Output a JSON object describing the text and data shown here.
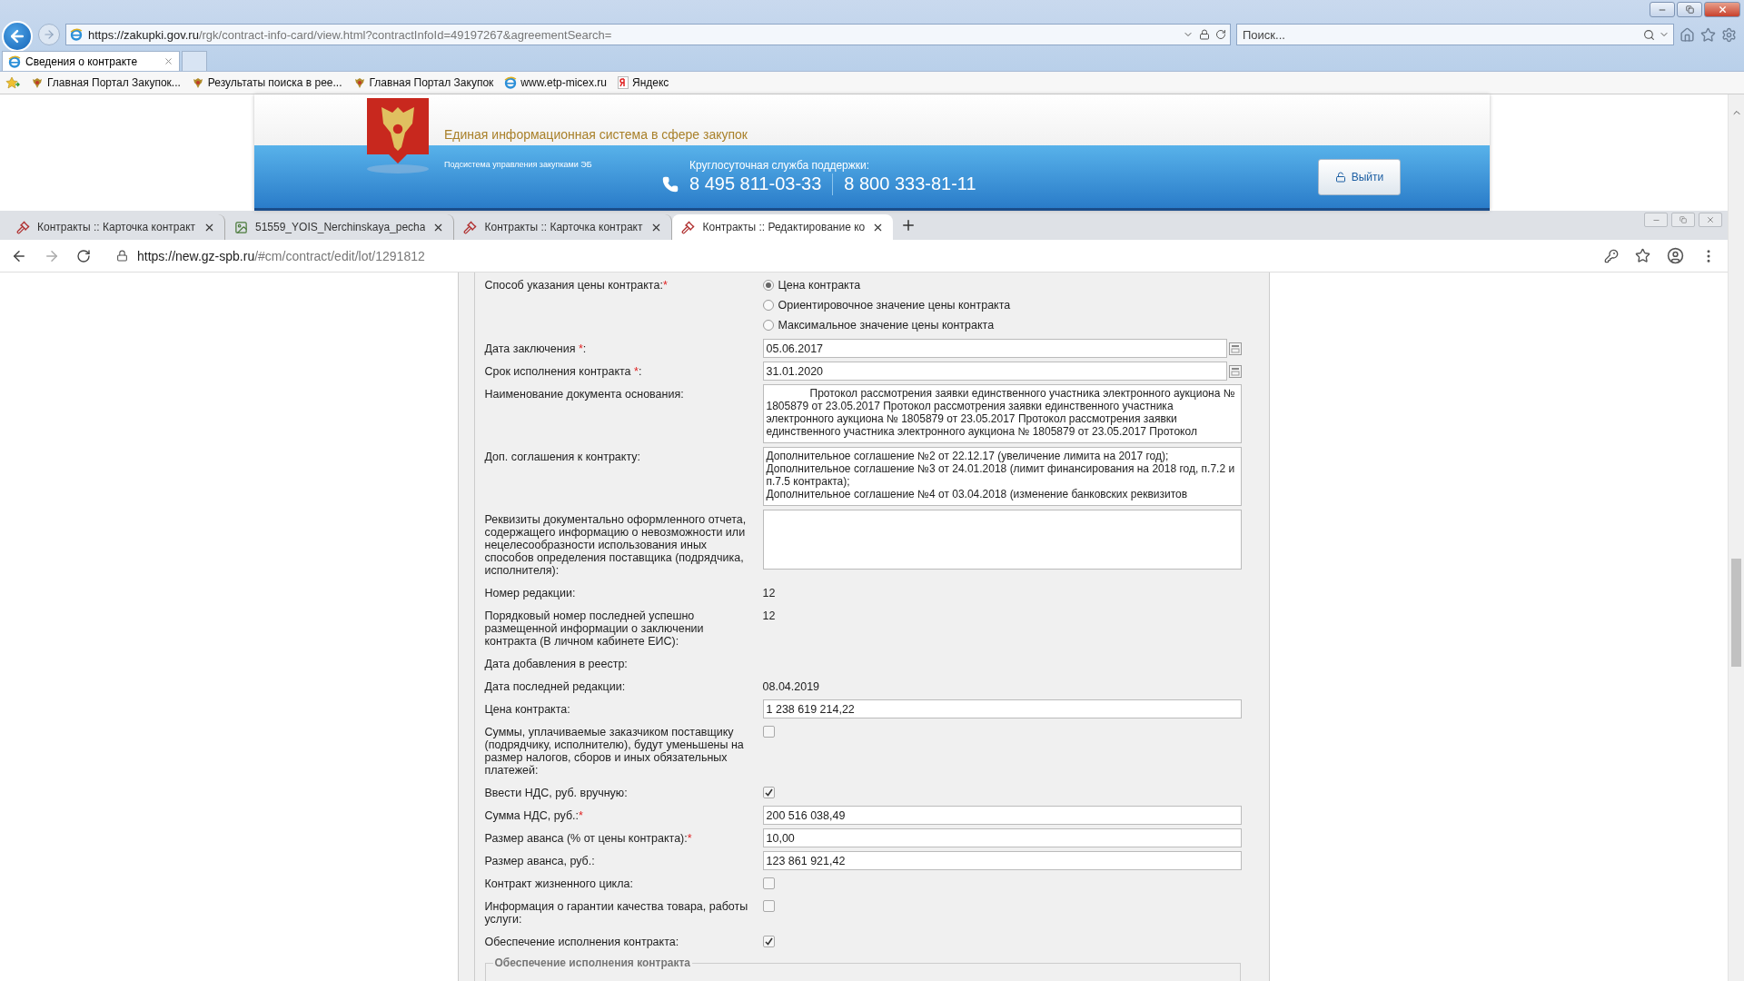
{
  "ie": {
    "address_host": "https://zakupki.gov.ru",
    "address_path": "/rgk/contract-info-card/view.html?contractInfoId=49197267&agreementSearch=",
    "search_placeholder": "Поиск...",
    "tab": {
      "title": "Сведения о контракте",
      "selected": true
    },
    "favorites": [
      {
        "kind": "gov",
        "label": "Главная Портал Закупок..."
      },
      {
        "kind": "gov",
        "label": "Результаты поиска в рее..."
      },
      {
        "kind": "gov",
        "label": "Главная Портал Закупок"
      },
      {
        "kind": "web",
        "label": "www.etp-micex.ru"
      },
      {
        "kind": "search",
        "label": "Яндекс"
      }
    ]
  },
  "eis_header": {
    "title": "Единая информационная система в сфере закупок",
    "subsystem": "Подсистема управления закупками ЭБ",
    "support_label": "Круглосуточная служба поддержки:",
    "phones": [
      "8 495 811-03-33",
      "8 800 333-81-11"
    ],
    "logout": "Выйти"
  },
  "chrome": {
    "tabs": [
      {
        "kind": "app",
        "title": "Контракты :: Карточка контракт",
        "selected": false
      },
      {
        "kind": "doc",
        "title": "51559_YOIS_Nerchinskaya_pecha",
        "selected": false
      },
      {
        "kind": "app",
        "title": "Контракты :: Карточка контракт",
        "selected": false
      },
      {
        "kind": "app",
        "title": "Контракты :: Редактирование ко",
        "selected": true
      }
    ],
    "address_host": "https://new.gz-spb.ru",
    "address_path": "/#cm/contract/edit/lot/1291812"
  },
  "form": {
    "rows": [
      {
        "kind": "radio",
        "label": "Способ указания цены контракта:",
        "required_mark": "*",
        "options": [
          {
            "label": "Цена контракта",
            "selected": true
          },
          {
            "label": "Ориентировочное значение цены контракта",
            "selected": false
          },
          {
            "label": "Максимальное значение цены контракта",
            "selected": false
          }
        ]
      },
      {
        "kind": "date",
        "label": "Дата заключения ",
        "required_mark": "*",
        "label_tail": ":",
        "value": "05.06.2017"
      },
      {
        "kind": "date",
        "label": "Срок исполнения контракта ",
        "required_mark": "*",
        "label_tail": ":",
        "value": "31.01.2020"
      },
      {
        "kind": "textarea",
        "label": "Наименование документа основания:",
        "value": "Протокол рассмотрения заявки единственного участника электронного аукциона № 1805879 от 23.05.2017 Протокол рассмотрения заявки единственного участника электронного аукциона № 1805879 от 23.05.2017 Протокол рассмотрения заявки единственного участника электронного аукциона № 1805879 от 23.05.2017 Протокол",
        "indent": true
      },
      {
        "kind": "textarea",
        "label": "Доп. соглашения к контракту:",
        "value": "Дополнительное соглашение №2 от 22.12.17 (увеличение лимита на 2017 год);\nДополнительное соглашение №3 от 24.01.2018 (лимит финансирования на 2018 год, п.7.2 и п.7.5 контракта);\nДополнительное соглашение №4 от 03.04.2018 (изменение банковских реквизитов",
        "indent": false
      },
      {
        "kind": "textarea",
        "label": "Реквизиты документально оформленного отчета, содержащего информацию о невозможности или нецелесообразности использования иных способов определения поставщика (подрядчика, исполнителя):",
        "value": ""
      },
      {
        "kind": "text",
        "label": "Номер редакции:",
        "value": "12"
      },
      {
        "kind": "text",
        "label": "Порядковый номер последней успешно размещенной информации о заключении контракта (В личном кабинете ЕИС):",
        "value": "12"
      },
      {
        "kind": "text",
        "label": "Дата добавления в реестр:"
      },
      {
        "kind": "text",
        "label": "Дата последней редакции:",
        "value": "08.04.2019"
      },
      {
        "kind": "input",
        "label": "Цена контракта:",
        "value": "1 238 619 214,22"
      },
      {
        "kind": "checkbox",
        "label": "Суммы, уплачиваемые заказчиком поставщику (подрядчику, исполнителю), будут уменьшены на размер налогов, сборов и иных обязательных платежей:",
        "checked": false
      },
      {
        "kind": "checkbox",
        "label": "Ввести НДС, руб. вручную:",
        "checked": true
      },
      {
        "kind": "input",
        "label": "Сумма НДС, руб.:",
        "required_mark": "*",
        "value": "200 516 038,49"
      },
      {
        "kind": "input",
        "label": "Размер аванса (% от цены контракта):",
        "required_mark": "*",
        "value": "10,00"
      },
      {
        "kind": "input",
        "label": "Размер аванса, руб.:",
        "value": "123 861 921,42"
      },
      {
        "kind": "checkbox",
        "label": "Контракт жизненного цикла:",
        "checked": false
      },
      {
        "kind": "checkbox",
        "label": "Информация о гарантии качества товара, работы услуги:",
        "checked": false
      },
      {
        "kind": "checkbox",
        "label": "Обеспечение исполнения контракта:",
        "checked": true
      }
    ],
    "fieldset_legend": "Обеспечение исполнения контракта"
  }
}
